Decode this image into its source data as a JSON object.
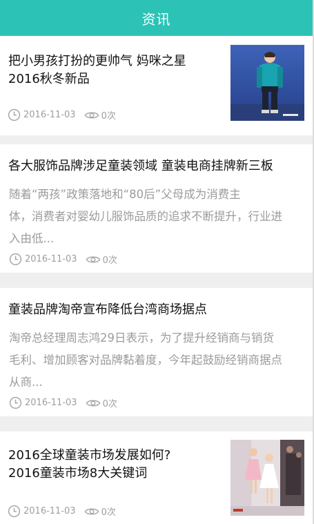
{
  "header": {
    "title": "资讯"
  },
  "articles": [
    {
      "title_line1": "把小男孩打扮的更帅气 妈咪之星",
      "title_line2": "2016秋冬新品",
      "date": "2016-11-03",
      "views": "0次",
      "thumb": "boy-in-teal-jacket-photo"
    },
    {
      "title": "各大服饰品牌涉足童装领域 童装电商挂牌新三板",
      "summary_lines": [
        "随着“两孩”政策落地和“80后”父母成为消费主",
        "体，消费者对婴幼儿服饰品质的追求不断提升，行业进",
        "入由低..."
      ],
      "date": "2016-11-03",
      "views": "0次"
    },
    {
      "title": "童装品牌淘帝宣布降低台湾商场据点",
      "summary_lines": [
        "淘帝总经理周志鸿29日表示，为了提升经销商与销货",
        "毛利、增加顾客对品牌黏着度，今年起鼓励经销商据点",
        "从商..."
      ],
      "date": "2016-11-03",
      "views": "0次"
    },
    {
      "title_line1": "2016全球童装市场发展如何?",
      "title_line2": "2016童装市场8大关键词",
      "date": "2016-11-03",
      "views": "0次",
      "thumb": "kids-fashion-runway-photo"
    }
  ],
  "icons": {
    "clock": "clock-icon",
    "eye": "eye-icon"
  },
  "colors": {
    "accent": "#2cc3b6",
    "meta": "#9e9e9e",
    "summary": "#9b9b9b"
  }
}
